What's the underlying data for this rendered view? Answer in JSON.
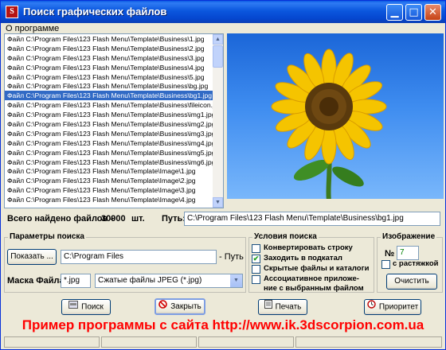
{
  "window": {
    "title": "Поиск графических файлов",
    "icon_label": "S",
    "controls": [
      "minimize-icon",
      "maximize-icon",
      "close-icon"
    ]
  },
  "menu": {
    "items": [
      "О программе"
    ]
  },
  "file_list": {
    "rows": [
      "Файл C:\\Program Files\\123 Flash Menu\\Template\\Business\\1.jpg",
      "Файл C:\\Program Files\\123 Flash Menu\\Template\\Business\\2.jpg",
      "Файл C:\\Program Files\\123 Flash Menu\\Template\\Business\\3.jpg",
      "Файл C:\\Program Files\\123 Flash Menu\\Template\\Business\\4.jpg",
      "Файл C:\\Program Files\\123 Flash Menu\\Template\\Business\\5.jpg",
      "Файл C:\\Program Files\\123 Flash Menu\\Template\\Business\\bg.jpg",
      "Файл C:\\Program Files\\123 Flash Menu\\Template\\Business\\bg1.jpg",
      "Файл C:\\Program Files\\123 Flash Menu\\Template\\Business\\fileicon.jpg",
      "Файл C:\\Program Files\\123 Flash Menu\\Template\\Business\\img1.jpg",
      "Файл C:\\Program Files\\123 Flash Menu\\Template\\Business\\img2.jpg",
      "Файл C:\\Program Files\\123 Flash Menu\\Template\\Business\\img3.jpg",
      "Файл C:\\Program Files\\123 Flash Menu\\Template\\Business\\img4.jpg",
      "Файл C:\\Program Files\\123 Flash Menu\\Template\\Business\\img5.jpg",
      "Файл C:\\Program Files\\123 Flash Menu\\Template\\Business\\img6.jpg",
      "Файл C:\\Program Files\\123 Flash Menu\\Template\\Image\\1.jpg",
      "Файл C:\\Program Files\\123 Flash Menu\\Template\\Image\\2.jpg",
      "Файл C:\\Program Files\\123 Flash Menu\\Template\\Image\\3.jpg",
      "Файл C:\\Program Files\\123 Flash Menu\\Template\\Image\\4.jpg"
    ],
    "selected_index": 6
  },
  "summary": {
    "total_label": "Всего найдено файлов -",
    "total_value": "30900",
    "total_unit": "шт.",
    "path_label": "Путь:",
    "path_value": "C:\\Program Files\\123 Flash Menu\\Template\\Business\\bg1.jpg"
  },
  "search_params": {
    "legend": "Параметры поиска",
    "show_button": "Показать ...",
    "folder_value": "C:\\Program Files",
    "path_suffix": "- Путь",
    "mask_label": "Маска Файла:",
    "mask_value": "*.jpg",
    "type_value": "Сжатые файлы JPEG (*.jpg)"
  },
  "conditions": {
    "legend": "Условия поиска",
    "options": [
      {
        "label": "Конвертировать строку",
        "checked": false
      },
      {
        "label": "Заходить в подкатал",
        "checked": true
      },
      {
        "label": "Скрытые файлы и каталоги",
        "checked": false
      },
      {
        "label": "Ассоциативное приложе-",
        "checked": false
      }
    ],
    "continuation": "ние с выбранным файлом"
  },
  "image": {
    "legend": "Изображение",
    "number_label": "№",
    "number_value": "7",
    "stretch_label": "с растяжкой",
    "stretch_checked": false,
    "clear_button": "Очистить"
  },
  "actions": {
    "search": "Поиск",
    "close": "Закрыть",
    "print": "Печать",
    "priority": "Приоритет"
  },
  "promo_text": "Пример программы с сайта http://www.ik.3dscorpion.com.ua",
  "colors": {
    "titlebar": "#0b57de",
    "selection": "#316ac5",
    "promo": "#ff0000"
  }
}
